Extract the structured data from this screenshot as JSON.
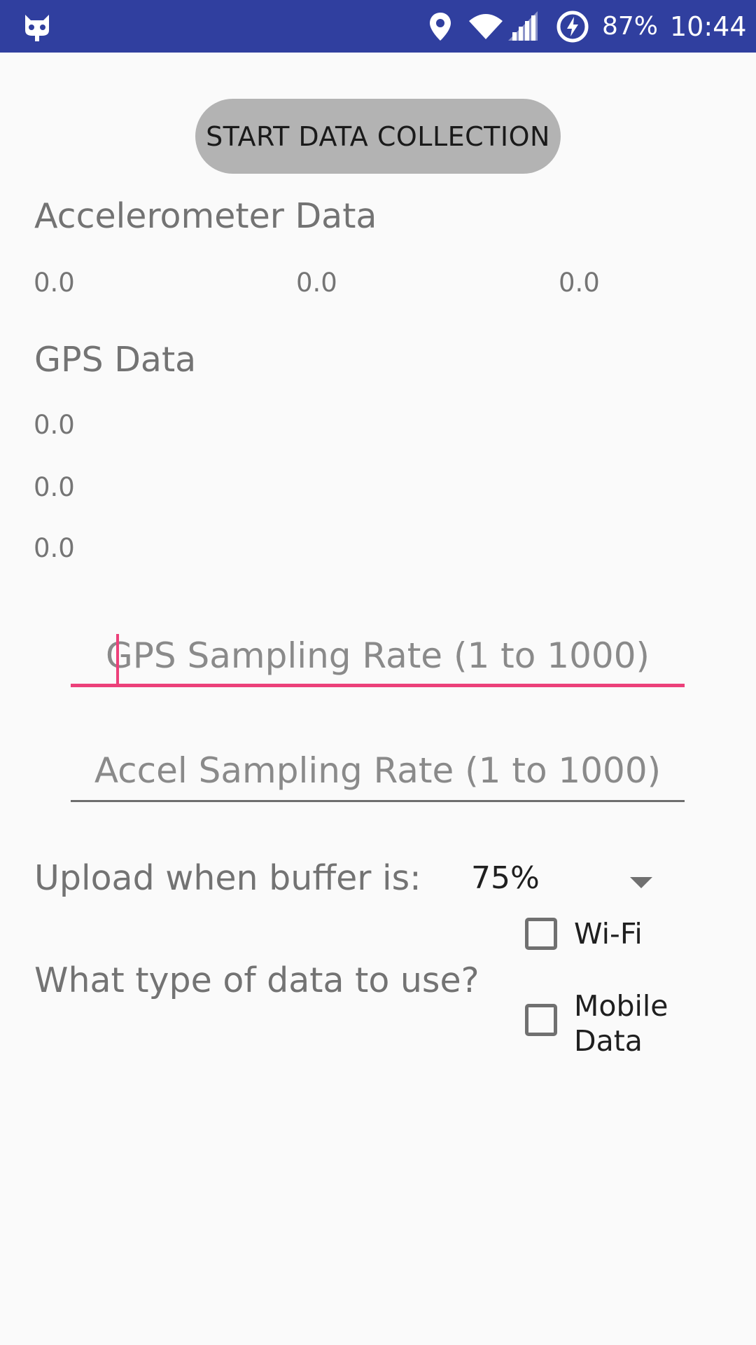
{
  "status_bar": {
    "battery": "87%",
    "time": "10:44",
    "icons": [
      "cyanogen-icon",
      "location-icon",
      "wifi-icon",
      "signal-icon",
      "battery-charging-icon"
    ],
    "background_color": "#303f9f"
  },
  "main": {
    "start_button": "START DATA COLLECTION",
    "accelerometer": {
      "heading": "Accelerometer Data",
      "values": [
        "0.0",
        "0.0",
        "0.0"
      ]
    },
    "gps": {
      "heading": "GPS Data",
      "values": [
        "0.0",
        "0.0",
        "0.0"
      ]
    },
    "gps_rate_input": {
      "placeholder": "GPS Sampling Rate (1 to 1000)",
      "value": "",
      "focused": true
    },
    "accel_rate_input": {
      "placeholder": "Accel Sampling Rate (1 to 1000)",
      "value": ""
    },
    "upload": {
      "label": "Upload when buffer is:",
      "selected": "75%"
    },
    "data_type": {
      "label": "What type of data to use?",
      "options": [
        {
          "label": "Wi-Fi",
          "checked": false
        },
        {
          "label": "Mobile Data",
          "checked": false
        }
      ]
    },
    "accent_color": "#ec407a"
  }
}
